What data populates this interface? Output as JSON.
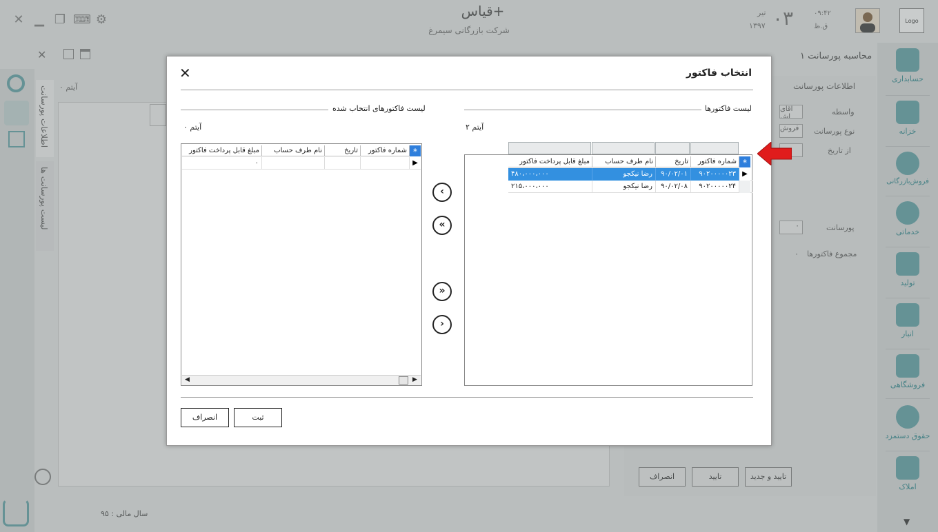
{
  "app": {
    "title": "قیاس+",
    "company": "شرکت بازرگانی سیمرغ",
    "date": {
      "day": "۰۳",
      "month": "تیر",
      "year": "۱۳۹۷"
    },
    "time": {
      "value": "۰۹:۴۲",
      "ampm": "ق.ظ"
    },
    "logo_label": "Logo",
    "fiscal_year": "سال مالی : ۹۵",
    "page_heading": "محاسبه پورسانت ۱",
    "bg_count": "۰ آیتم"
  },
  "window_controls": [
    "close-icon",
    "minimize-icon",
    "restore-icon",
    "keyboard-icon",
    "gear-icon"
  ],
  "right_nav": {
    "items": [
      {
        "label": "حسابداری",
        "icon": "calculator-icon"
      },
      {
        "label": "خزانه",
        "icon": "safe-icon"
      },
      {
        "label": "فروش‌بازرگانی",
        "icon": "globe-ship-icon"
      },
      {
        "label": "خدماتی",
        "icon": "gear-icon"
      },
      {
        "label": "تولید",
        "icon": "worker-icon"
      },
      {
        "label": "انبار",
        "icon": "warehouse-icon"
      },
      {
        "label": "فروشگاهی",
        "icon": "store-icon"
      },
      {
        "label": "حقوق دستمزد",
        "icon": "coins-icon"
      },
      {
        "label": "املاک",
        "icon": "house-icon"
      }
    ]
  },
  "left_tabs": [
    "اطلاعات پورسانت",
    "لیست پورسانت ها"
  ],
  "bg_form": {
    "section_title": "اطلاعات پورسانت",
    "fields": [
      {
        "label": "واسطه",
        "value": "اقای اش"
      },
      {
        "label": "نوع پورسانت",
        "value": "فروش"
      },
      {
        "label": "از تاریخ",
        "value": ""
      },
      {
        "label": "پورسانت",
        "value": "۰"
      },
      {
        "label": "مجموع فاکتورها",
        "value": "۰"
      }
    ],
    "buttons": {
      "confirm_new": "تایید و جدید",
      "confirm": "تایید",
      "cancel": "انصراف"
    }
  },
  "dialog": {
    "title": "انتخاب فاکتور",
    "available": {
      "title": "لیست فاکتورها",
      "count": "۲ آیتم",
      "columns": [
        "شماره فاکتور",
        "تاریخ",
        "نام طرف حساب",
        "مبلغ قابل پرداخت فاکتور"
      ],
      "rows": [
        [
          "۹۰۲۰۰۰۰۰۲۳",
          "۹۰/۰۲/۰۱",
          "رضا نیکجو",
          "۴۸۰،۰۰۰،۰۰۰"
        ],
        [
          "۹۰۲۰۰۰۰۰۲۴",
          "۹۰/۰۲/۰۸",
          "رضا نیکجو",
          "۲۱۵،۰۰۰،۰۰۰"
        ]
      ]
    },
    "selected": {
      "title": "لیست فاکتورهای انتخاب شده",
      "count": "۰ آیتم",
      "columns": [
        "شماره فاکتور",
        "تاریخ",
        "نام طرف حساب",
        "مبلغ قابل پرداخت فاکتور"
      ],
      "summary_value": "۰"
    },
    "move_buttons": {
      "move_one_left": "‹",
      "move_all_left": "«",
      "move_all_right": "»",
      "move_one_right": "›"
    },
    "buttons": {
      "submit": "ثبت",
      "cancel": "انصراف"
    },
    "close_glyph": "✕"
  },
  "colors": {
    "selection": "#3390e0",
    "accent": "#3b8f95",
    "pointer_arrow": "#e01c1c"
  }
}
